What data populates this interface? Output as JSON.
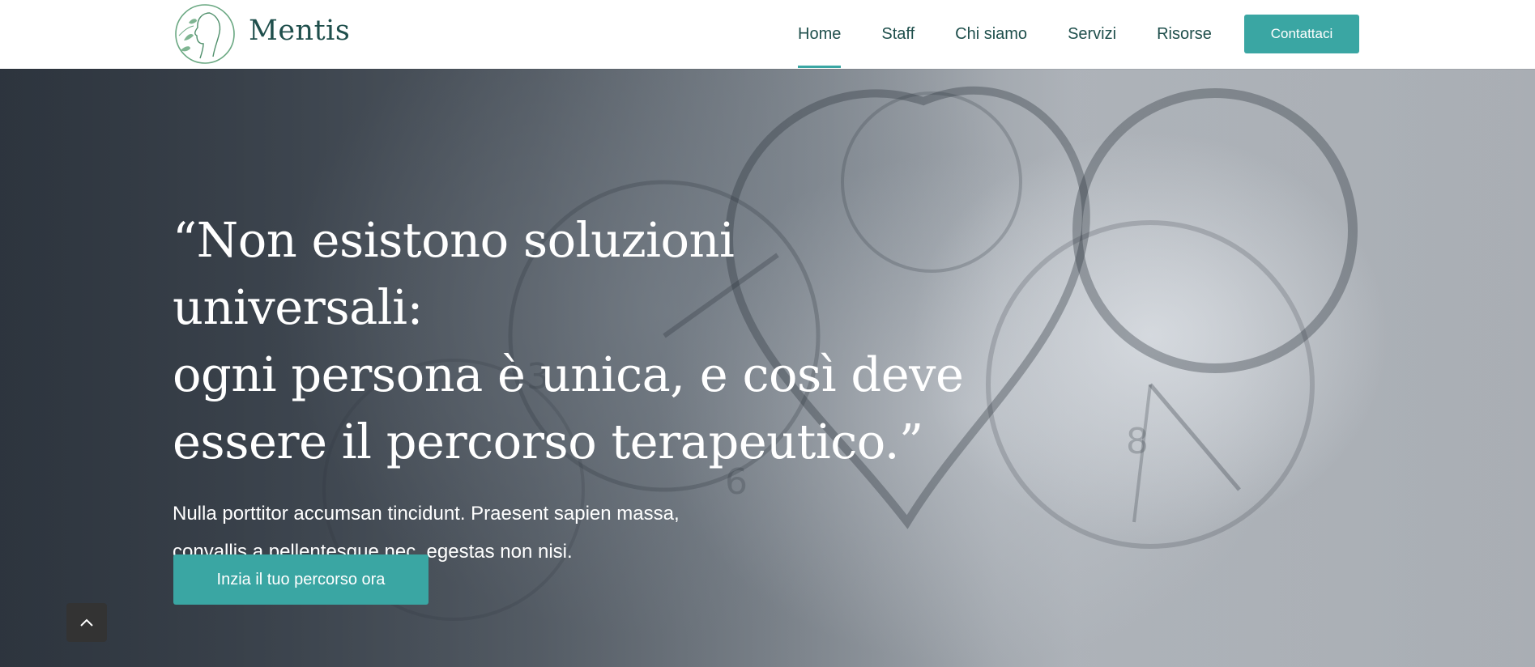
{
  "brand": {
    "name": "Mentis",
    "logo_icon": "leafy-profile-logo"
  },
  "nav": {
    "items": [
      {
        "label": "Home",
        "active": true
      },
      {
        "label": "Staff",
        "active": false
      },
      {
        "label": "Chi siamo",
        "active": false
      },
      {
        "label": "Servizi",
        "active": false
      },
      {
        "label": "Risorse",
        "active": false
      }
    ],
    "cta_label": "Contattaci"
  },
  "hero": {
    "quote_lines": [
      "“Non esistono soluzioni universali:",
      "ogni persona è unica, e così deve",
      "essere il percorso terapeutico.”"
    ],
    "text_lines": [
      "Nulla porttitor accumsan tincidunt. Praesent sapien massa,",
      "convallis a pellentesque nec, egestas non nisi."
    ],
    "cta_label": "Inzia il tuo percorso ora",
    "background_icon": "clocks-heart-background"
  },
  "scroll_top": {
    "icon": "chevron-up-icon"
  },
  "colors": {
    "accent": "#3aa6a3",
    "nav_text": "#1f4f4c",
    "hero_text": "#ffffff",
    "scroll_top_bg": "#333333"
  }
}
